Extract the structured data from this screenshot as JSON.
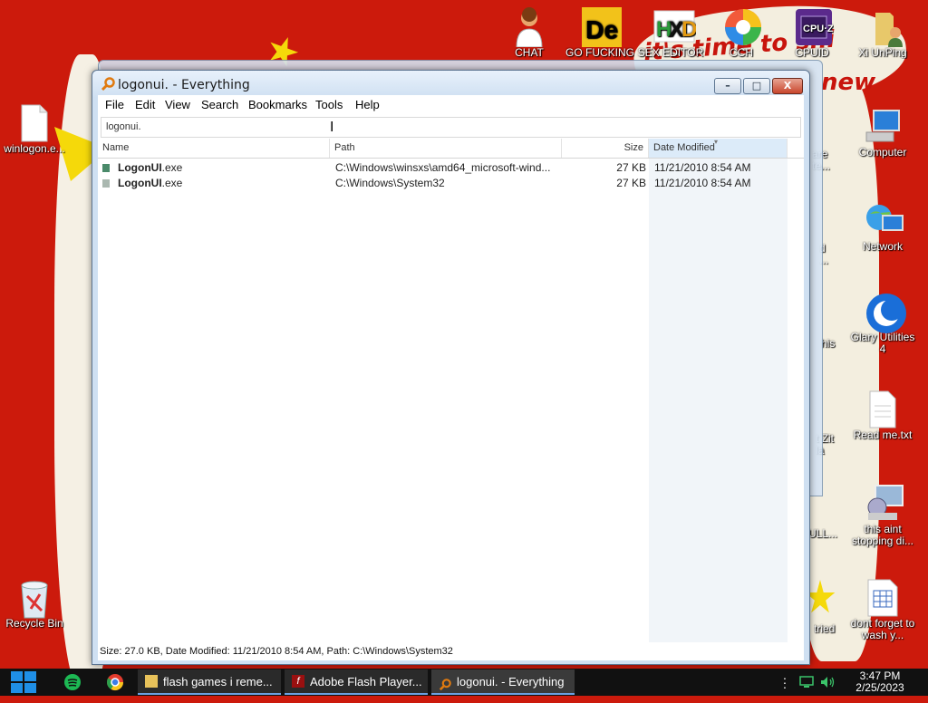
{
  "window": {
    "title": "logonui. - Everything",
    "controls": {
      "minimize": "–",
      "maximize": "□",
      "close": "X"
    }
  },
  "menu": [
    "File",
    "Edit",
    "View",
    "Search",
    "Bookmarks",
    "Tools",
    "Help"
  ],
  "search": {
    "value": "logonui."
  },
  "columns": {
    "name": "Name",
    "path": "Path",
    "size": "Size",
    "date": "Date Modified"
  },
  "rows": [
    {
      "name_bold": "LogonUI",
      "name_rest": ".exe",
      "path": "C:\\Windows\\winsxs\\amd64_microsoft-wind...",
      "size": "27 KB",
      "date": "11/21/2010 8:54 AM"
    },
    {
      "name_bold": "LogonUI",
      "name_rest": ".exe",
      "path": "C:\\Windows\\System32",
      "size": "27 KB",
      "date": "11/21/2010 8:54 AM"
    }
  ],
  "status_text": "Size: 27.0 KB, Date Modified: 11/21/2010 8:54 AM, Path: C:\\Windows\\System32",
  "desktop_icons_top": [
    {
      "label": "CHAT"
    },
    {
      "label": "GO FUCKING"
    },
    {
      "label": "SEX EDITOR"
    },
    {
      "label": "CCH"
    },
    {
      "label": "CPUID"
    },
    {
      "label": "Xi UnPing"
    }
  ],
  "desktop_icons_left": [
    {
      "label": "winlogon.e..."
    },
    {
      "label": "Recycle Bin"
    }
  ],
  "desktop_icons_right": [
    {
      "label": "Computer"
    },
    {
      "label": "Network"
    },
    {
      "label": "Glary Utilities 4"
    },
    {
      "label": "Read me.txt"
    },
    {
      "label": "this aint stopping di..."
    },
    {
      "label": "dont forget to wash y..."
    }
  ],
  "partial_labels": [
    "are",
    "te...",
    "d",
    "...",
    "his",
    "t Zit",
    "la",
    "ULL...",
    "tried"
  ],
  "wallpaper_text": {
    "line1": "it's time to ",
    "line2": "shi",
    "line3": "new"
  },
  "taskbar": {
    "buttons": [
      {
        "label": "flash games i reme..."
      },
      {
        "label": "Adobe Flash Player..."
      },
      {
        "label": "logonui. - Everything"
      }
    ],
    "clock_time": "3:47 PM",
    "clock_date": "2/25/2023"
  },
  "colors": {
    "wallpaper": "#cc1a0c",
    "accent": "#3c78d8",
    "star": "#f5d90a"
  }
}
